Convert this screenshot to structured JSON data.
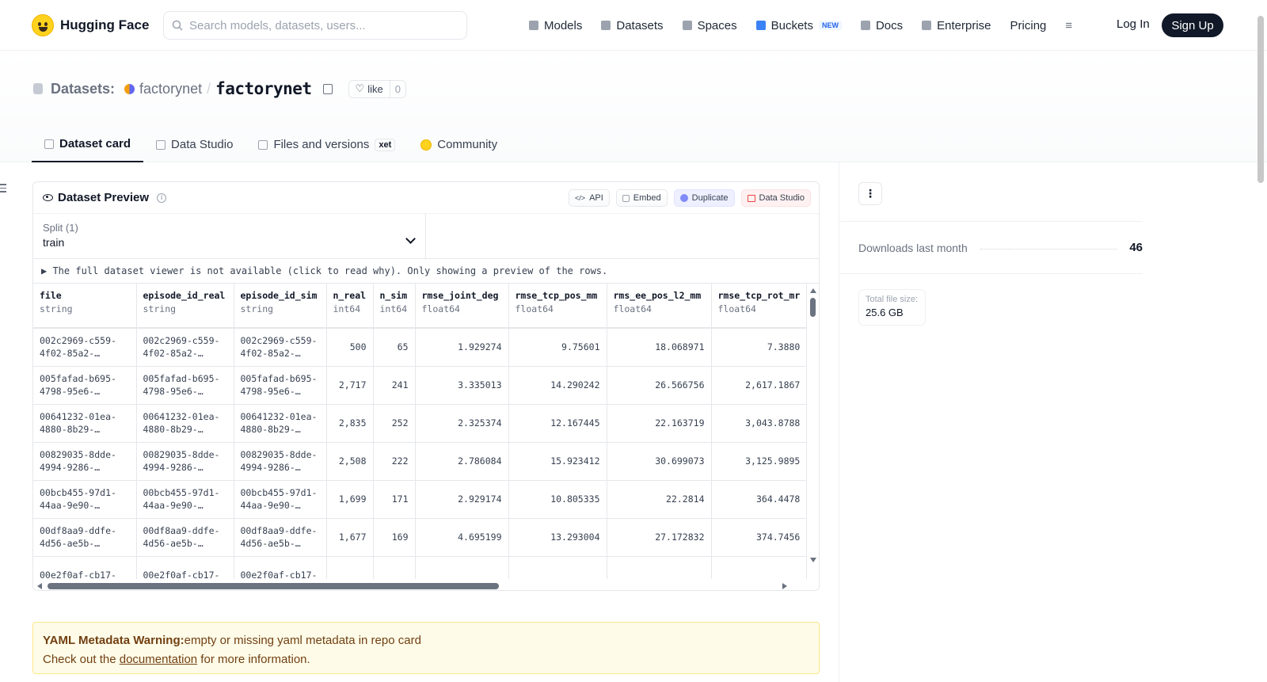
{
  "nav": {
    "logo_text": "Hugging Face",
    "search_placeholder": "Search models, datasets, users...",
    "links": [
      {
        "label": "Models",
        "icon": "cube-icon"
      },
      {
        "label": "Datasets",
        "icon": "database-icon"
      },
      {
        "label": "Spaces",
        "icon": "grid-icon"
      },
      {
        "label": "Buckets",
        "icon": "bucket-icon",
        "badge": "NEW"
      },
      {
        "label": "Docs",
        "icon": "book-icon"
      },
      {
        "label": "Enterprise",
        "icon": "enterprise-icon"
      },
      {
        "label": "Pricing"
      }
    ],
    "more_icon": "≡",
    "login": "Log In",
    "signup": "Sign Up"
  },
  "header": {
    "section_label": "Datasets:",
    "org": "factorynet",
    "separator": "/",
    "repo": "factorynet",
    "like_label": "like",
    "like_count": "0",
    "tabs": [
      {
        "label": "Dataset card",
        "active": true
      },
      {
        "label": "Data Studio"
      },
      {
        "label": "Files and versions",
        "badge": "xet"
      },
      {
        "label": "Community"
      }
    ]
  },
  "preview": {
    "title": "Dataset Preview",
    "buttons": [
      "API",
      "Embed",
      "Duplicate",
      "Data Studio"
    ],
    "split_label": "Split (1)",
    "split_value": "train",
    "notice": "▶ The full dataset viewer is not available (click to read why). Only showing a preview of the rows.",
    "columns": [
      {
        "name": "file",
        "type": "string"
      },
      {
        "name": "episode_id_real",
        "type": "string"
      },
      {
        "name": "episode_id_sim",
        "type": "string"
      },
      {
        "name": "n_real",
        "type": "int64"
      },
      {
        "name": "n_sim",
        "type": "int64"
      },
      {
        "name": "rmse_joint_deg",
        "type": "float64"
      },
      {
        "name": "rmse_tcp_pos_mm",
        "type": "float64"
      },
      {
        "name": "rms_ee_pos_l2_mm",
        "type": "float64"
      },
      {
        "name": "rmse_tcp_rot_mr",
        "type": "float64"
      }
    ],
    "rows": [
      {
        "id": [
          "002c2969-c559-",
          "4f02-85a2-…"
        ],
        "n_real": "500",
        "n_sim": "65",
        "joint": "1.929274",
        "tcp": "9.75601",
        "ee": "18.068971",
        "rot": "7.3880"
      },
      {
        "id": [
          "005fafad-b695-",
          "4798-95e6-…"
        ],
        "n_real": "2,717",
        "n_sim": "241",
        "joint": "3.335013",
        "tcp": "14.290242",
        "ee": "26.566756",
        "rot": "2,617.1867"
      },
      {
        "id": [
          "00641232-01ea-",
          "4880-8b29-…"
        ],
        "n_real": "2,835",
        "n_sim": "252",
        "joint": "2.325374",
        "tcp": "12.167445",
        "ee": "22.163719",
        "rot": "3,043.8788"
      },
      {
        "id": [
          "00829035-8dde-",
          "4994-9286-…"
        ],
        "n_real": "2,508",
        "n_sim": "222",
        "joint": "2.786084",
        "tcp": "15.923412",
        "ee": "30.699073",
        "rot": "3,125.9895"
      },
      {
        "id": [
          "00bcb455-97d1-",
          "44aa-9e90-…"
        ],
        "n_real": "1,699",
        "n_sim": "171",
        "joint": "2.929174",
        "tcp": "10.805335",
        "ee": "22.2814",
        "rot": "364.4478"
      },
      {
        "id": [
          "00df8aa9-ddfe-",
          "4d56-ae5b-…"
        ],
        "n_real": "1,677",
        "n_sim": "169",
        "joint": "4.695199",
        "tcp": "13.293004",
        "ee": "27.172832",
        "rot": "374.7456"
      },
      {
        "id": [
          "00e2f0af-cb17-",
          ""
        ],
        "n_real": "",
        "n_sim": "",
        "joint": "",
        "tcp": "",
        "ee": "",
        "rot": ""
      }
    ]
  },
  "warning": {
    "title": "YAML Metadata Warning:",
    "text": "empty or missing yaml metadata in repo card",
    "line2_prefix": "Check out the ",
    "link": "documentation",
    "line2_suffix": " for more information."
  },
  "sidebar": {
    "menu_icon": "⋮",
    "downloads_label": "Downloads last month",
    "downloads_value": "46",
    "size_label": "Total file size:",
    "size_value": "25.6 GB"
  }
}
